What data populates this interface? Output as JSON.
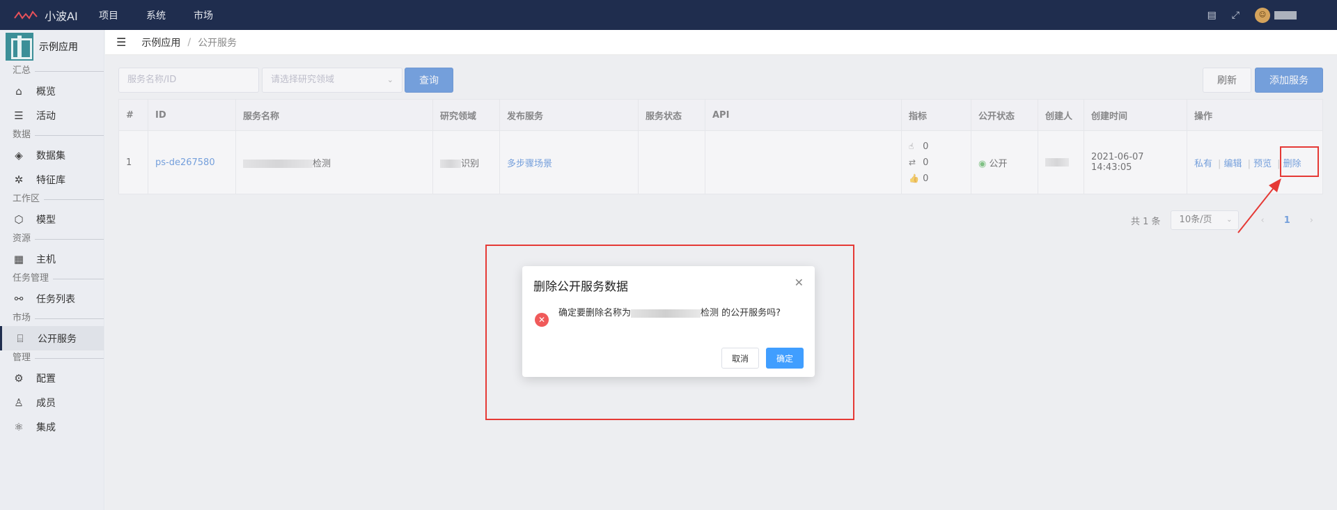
{
  "topbar": {
    "brand": "小波AI",
    "nav": [
      "项目",
      "系统",
      "市场"
    ]
  },
  "sidebar": {
    "app_name": "示例应用",
    "groups": [
      {
        "title": "汇总",
        "items": [
          "概览",
          "活动"
        ]
      },
      {
        "title": "数据",
        "items": [
          "数据集",
          "特征库"
        ]
      },
      {
        "title": "工作区",
        "items": [
          "模型"
        ]
      },
      {
        "title": "资源",
        "items": [
          "主机"
        ]
      },
      {
        "title": "任务管理",
        "items": [
          "任务列表"
        ]
      },
      {
        "title": "市场",
        "items": [
          "公开服务"
        ]
      },
      {
        "title": "管理",
        "items": [
          "配置",
          "成员",
          "集成"
        ]
      }
    ]
  },
  "breadcrumb": [
    "示例应用",
    "公开服务"
  ],
  "filters": {
    "search_placeholder": "服务名称/ID",
    "domain_placeholder": "请选择研究领域",
    "query_label": "查询"
  },
  "actions": {
    "refresh": "刷新",
    "add": "添加服务"
  },
  "table": {
    "headers": [
      "#",
      "ID",
      "服务名称",
      "研究领域",
      "发布服务",
      "服务状态",
      "API",
      "指标",
      "公开状态",
      "创建人",
      "创建时间",
      "操作"
    ],
    "rows": [
      {
        "index": "1",
        "id": "ps-de267580",
        "name_suffix": "检测",
        "domain_suffix": "识别",
        "published": "多步骤场景",
        "metrics": [
          "0",
          "0",
          "0"
        ],
        "public_status": "公开",
        "created": "2021-06-07 14:43:05",
        "ops": [
          "私有",
          "编辑",
          "预览",
          "删除"
        ]
      }
    ]
  },
  "pagination": {
    "total": "共 1 条",
    "page_size": "10条/页",
    "current": "1"
  },
  "dialog": {
    "title": "删除公开服务数据",
    "message_prefix": "确定要删除名称为",
    "message_suffix": "检测 的公开服务吗?",
    "cancel": "取消",
    "confirm": "确定"
  },
  "colors": {
    "topbar": "#1f2d4e",
    "primary": "#3a7bd5",
    "danger": "#e53935"
  }
}
